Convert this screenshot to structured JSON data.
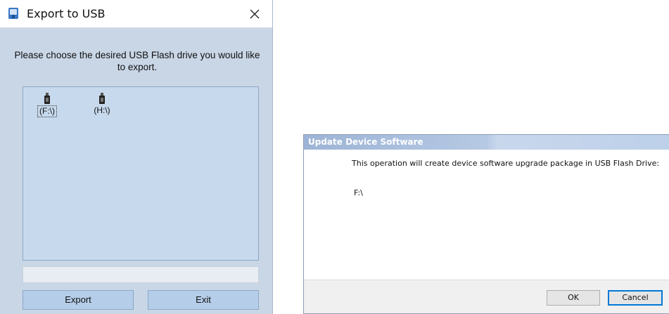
{
  "export_window": {
    "title": "Export to USB",
    "prompt": "Please choose the desired USB Flash drive you would like to export.",
    "drives": [
      {
        "label": "(F:\\)",
        "selected": true
      },
      {
        "label": "(H:\\)",
        "selected": false
      }
    ],
    "progress_fraction": 0,
    "export_label": "Export",
    "exit_label": "Exit"
  },
  "update_window": {
    "title": "Update Device Software",
    "message": "This operation will create device software upgrade package in USB Flash Drive:",
    "drive_path": "F:\\",
    "ok_label": "OK",
    "cancel_label": "Cancel"
  },
  "icons": {
    "app": "usb-export-app-icon",
    "close": "close-icon",
    "drive": "usb-drive-icon"
  },
  "colors": {
    "export_bg": "#c8d6e6",
    "list_bg": "#c7d9ed",
    "button_bg": "#b5cde9",
    "update_titlebar": "#9db4d6",
    "cancel_focus": "#0078d7"
  }
}
